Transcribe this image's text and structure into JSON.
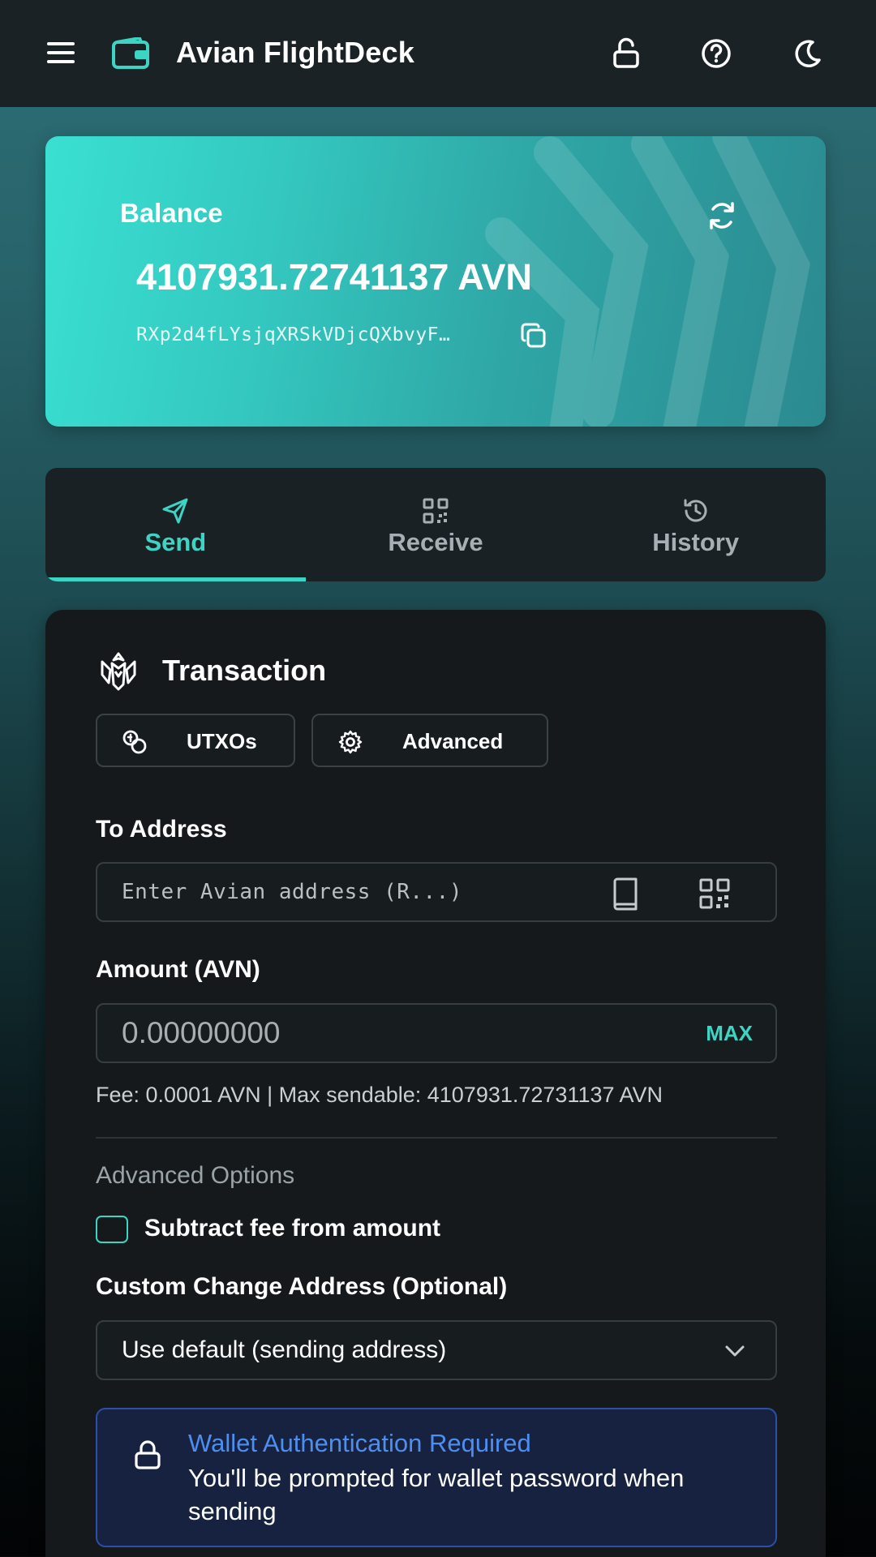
{
  "header": {
    "title": "Avian FlightDeck",
    "icons": [
      "menu-icon",
      "wallet-icon",
      "unlock-icon",
      "help-icon",
      "moon-icon"
    ]
  },
  "balance": {
    "label": "Balance",
    "value": "4107931.72741137 AVN",
    "address": "RXp2d4fLYsjqXRSkVDjcQXbvyF…",
    "icons": [
      "refresh-icon",
      "copy-icon"
    ]
  },
  "tabs": [
    {
      "label": "Send",
      "icon": "send-icon",
      "active": true
    },
    {
      "label": "Receive",
      "icon": "qr-code-icon",
      "active": false
    },
    {
      "label": "History",
      "icon": "history-icon",
      "active": false
    }
  ],
  "transaction": {
    "title": "Transaction",
    "utxos_label": "UTXOs",
    "advanced_label": "Advanced",
    "to_address_label": "To Address",
    "to_address_placeholder": "Enter Avian address (R...)",
    "amount_label": "Amount (AVN)",
    "amount_placeholder": "0.00000000",
    "max_label": "MAX",
    "fee_text": "Fee: 0.0001 AVN | Max sendable: 4107931.72731137 AVN",
    "advanced_options_heading": "Advanced Options",
    "subtract_fee_label": "Subtract fee from amount",
    "subtract_fee_checked": false,
    "change_address_label": "Custom Change Address (Optional)",
    "change_address_value": "Use default (sending address)",
    "auth_title": "Wallet Authentication Required",
    "auth_text": "You'll be prompted for wallet password when sending"
  },
  "colors": {
    "accent": "#3ed4c4",
    "header_bg": "#1b2226",
    "panel_bg": "#15191c",
    "auth_blue": "#4d8ff0"
  }
}
